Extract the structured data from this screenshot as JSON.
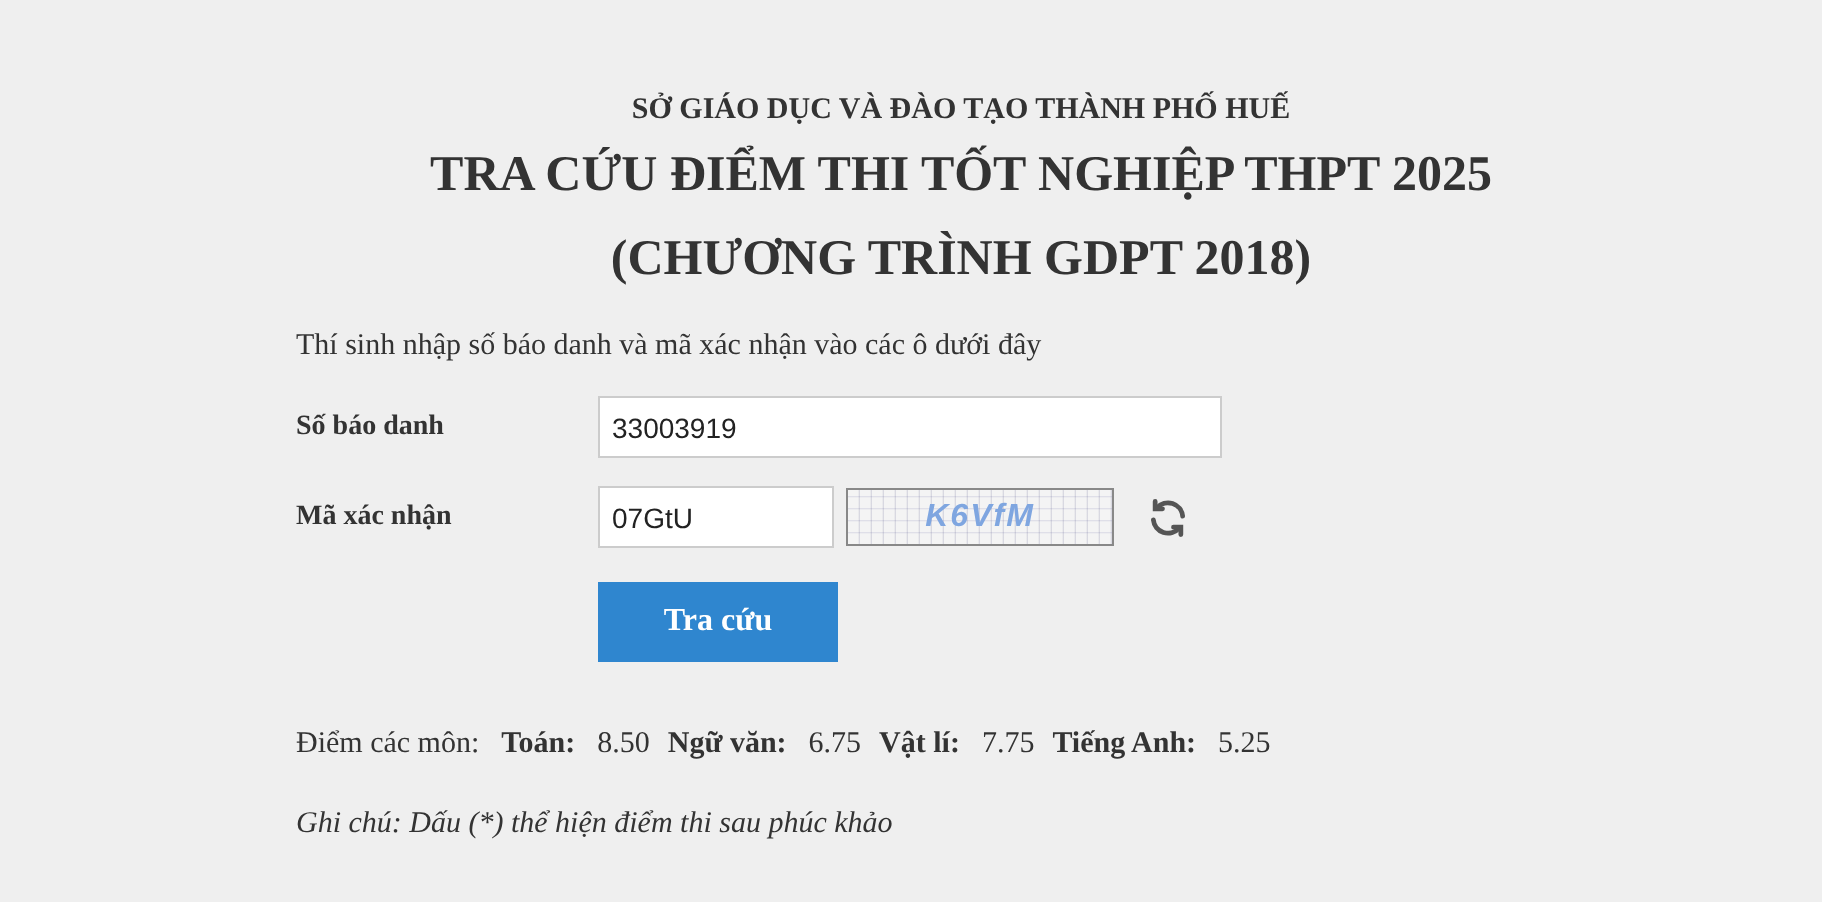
{
  "header": {
    "department": "SỞ GIÁO DỤC VÀ ĐÀO TẠO THÀNH PHỐ HUẾ",
    "title": "TRA CỨU ĐIỂM THI TỐT NGHIỆP THPT 2025",
    "subtitle": "(CHƯƠNG TRÌNH GDPT 2018)"
  },
  "form": {
    "intro": "Thí sinh nhập số báo danh và mã xác nhận vào các ô dưới đây",
    "candidate_number": {
      "label": "Số báo danh",
      "value": "33003919"
    },
    "captcha": {
      "label": "Mã xác nhận",
      "value": "07GtU",
      "image_text": "K6VfM"
    },
    "submit": "Tra cứu"
  },
  "results": {
    "label": "Điểm các môn:",
    "subjects": [
      {
        "name": "Toán:",
        "score": "8.50"
      },
      {
        "name": "Ngữ văn:",
        "score": "6.75"
      },
      {
        "name": "Vật lí:",
        "score": "7.75"
      },
      {
        "name": "Tiếng Anh:",
        "score": "5.25"
      }
    ]
  },
  "note": "Ghi chú: Dấu (*) thể hiện điểm thi sau phúc khảo"
}
